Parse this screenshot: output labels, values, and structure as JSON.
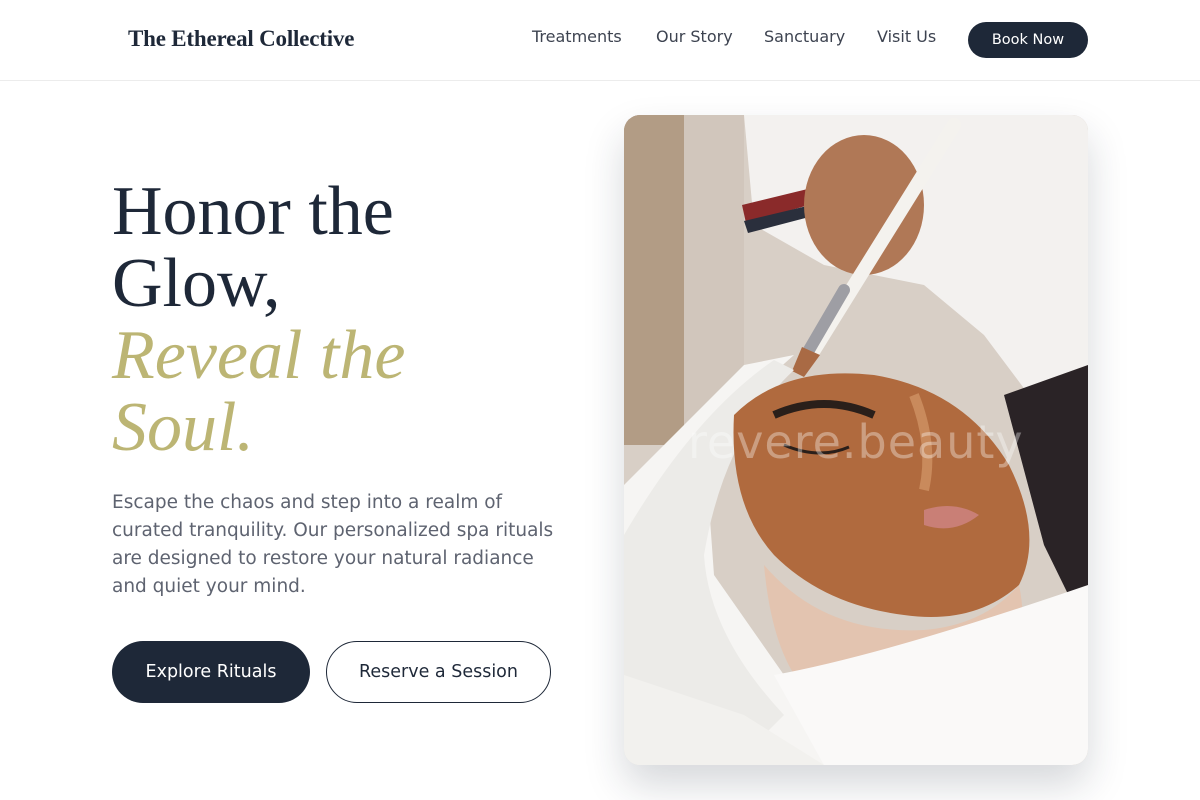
{
  "header": {
    "logo": "The Ethereal Collective",
    "nav": [
      "Treatments",
      "Our Story",
      "Sanctuary",
      "Visit Us"
    ],
    "cta": "Book Now"
  },
  "hero": {
    "title_line1": "Honor the",
    "title_line2": "Glow,",
    "title_accent_line1": "Reveal the",
    "title_accent_line2": "Soul.",
    "description": "Escape the chaos and step into a realm of curated tranquility. Our personalized spa rituals are designed to restore your natural radiance and quiet your mind.",
    "primary_button": "Explore Rituals",
    "secondary_button": "Reserve a Session"
  },
  "image": {
    "watermark": "revere.beauty"
  },
  "colors": {
    "navy": "#1e2838",
    "gold_accent": "#bcb574",
    "body_text": "#5e6370",
    "nav_text": "#3d4350"
  }
}
